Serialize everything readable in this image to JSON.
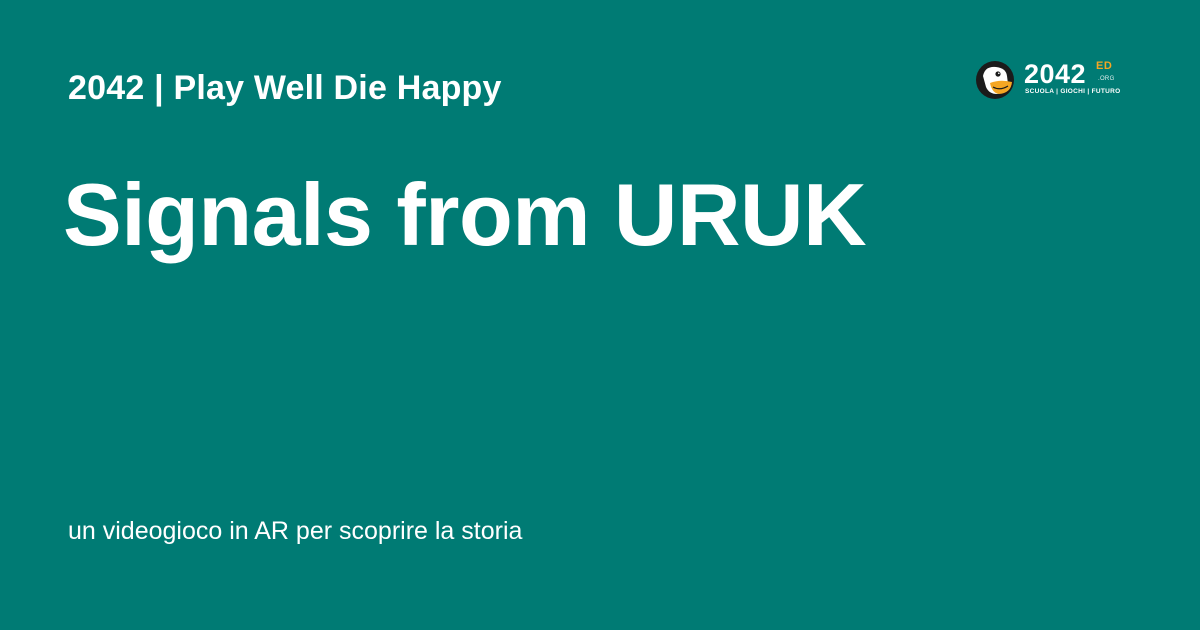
{
  "header": {
    "site_title": "2042 | Play Well Die Happy"
  },
  "main": {
    "title": "Signals from URUK",
    "subtitle": "un videogioco in AR per scoprire la storia"
  },
  "logo": {
    "icon": "mascot-face-icon",
    "number": "2042",
    "suffix": "ED",
    "domain": ".ORG",
    "tagline": "SCUOLA | GIOCHI | FUTURO"
  },
  "colors": {
    "background": "#007B74",
    "text": "#FFFFFF",
    "accent": "#F5A623"
  }
}
